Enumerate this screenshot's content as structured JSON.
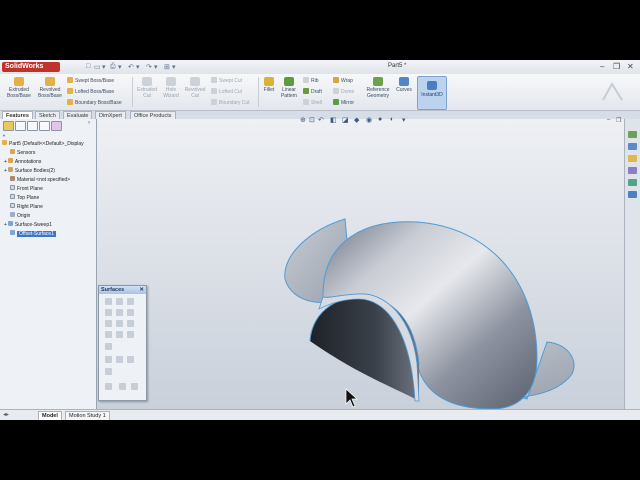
{
  "app": {
    "logo": "SolidWorks",
    "document_title": "Part5 *"
  },
  "quick_access": [
    "□",
    "▭",
    "▾",
    "⎙",
    "▾",
    "↶",
    "▾",
    "↷",
    "▾",
    "⊞",
    "▾"
  ],
  "window_controls": {
    "minimize": "–",
    "restore": "❐",
    "close": "✕"
  },
  "command_manager": {
    "extruded_boss": "Extruded Boss/Base",
    "revolved_boss": "Revolved Boss/Base",
    "swept_boss": "Swept Boss/Base",
    "lofted_boss": "Lofted Boss/Base",
    "boundary_boss": "Boundary Boss/Base",
    "extruded_cut": "Extruded Cut",
    "hole_wizard": "Hole Wizard",
    "revolved_cut": "Revolved Cut",
    "swept_cut": "Swept Cut",
    "lofted_cut": "Lofted Cut",
    "boundary_cut": "Boundary Cut",
    "fillet": "Fillet",
    "linear_pattern": "Linear Pattern",
    "rib": "Rib",
    "draft": "Draft",
    "shell": "Shell",
    "wrap": "Wrap",
    "dome": "Dome",
    "mirror": "Mirror",
    "reference_geometry": "Reference Geometry",
    "curves": "Curves",
    "instant3d": "Instant3D"
  },
  "tabs": [
    "Features",
    "Sketch",
    "Evaluate",
    "DimXpert",
    "Office Products"
  ],
  "feature_tree": [
    "Part5 (Default<<Default>_Display",
    "Sensors",
    "Annotations",
    "Surface Bodies(2)",
    "Material <not specified>",
    "Front Plane",
    "Top Plane",
    "Right Plane",
    "Origin",
    "Surface-Sweep1",
    "Offset-Surface1"
  ],
  "surfaces_toolbar": {
    "title": "Surfaces",
    "close": "✕"
  },
  "bottom_tabs": [
    "Model",
    "Motion Study 1"
  ],
  "colors": {
    "accent": "#3f74c9",
    "brand": "#c0332b",
    "edge": "#4f9bd6"
  }
}
